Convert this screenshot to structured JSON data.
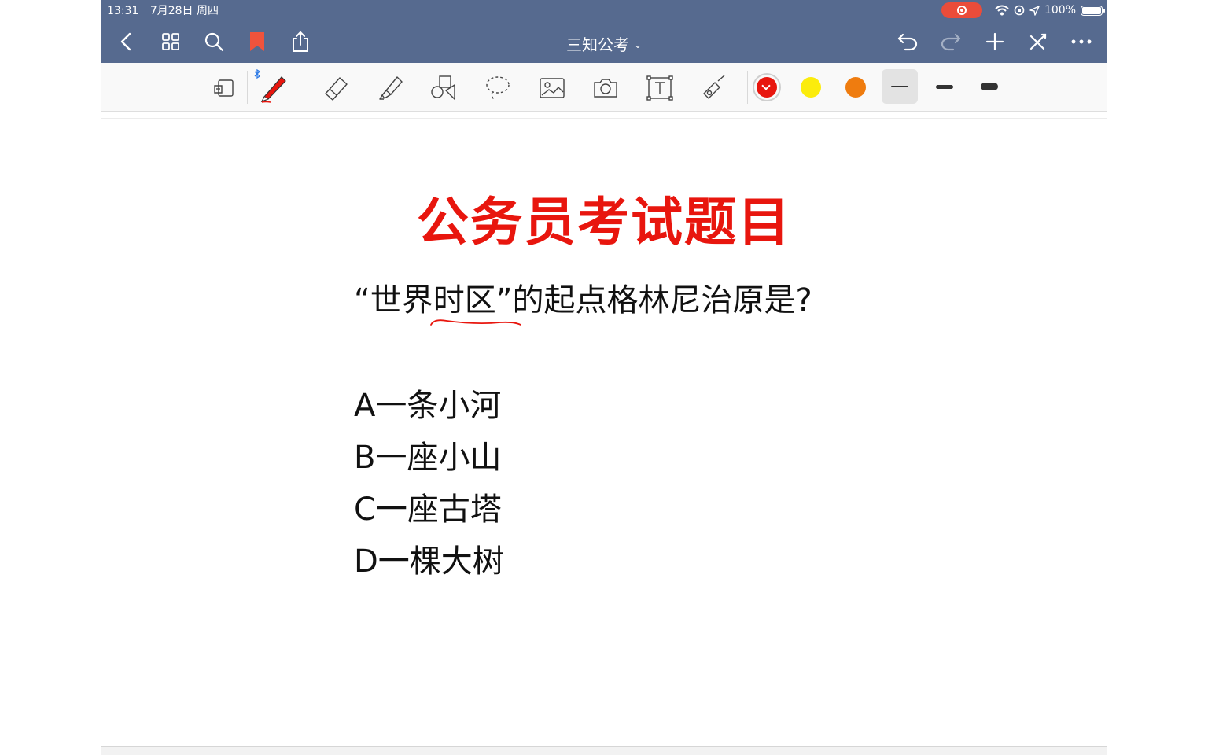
{
  "status_bar": {
    "time": "13:31",
    "date": "7月28日 周四",
    "battery": "100%"
  },
  "nav": {
    "title": "三知公考",
    "icons": [
      "back-icon",
      "grid-icon",
      "search-icon",
      "bookmark-icon",
      "share-icon",
      "undo-icon",
      "redo-icon",
      "add-icon",
      "close-edit-icon",
      "more-icon"
    ],
    "bookmark_color": "#f0533c",
    "bar_color": "#566a8f"
  },
  "toolbar": {
    "tools": [
      "read-mode-icon",
      "pen-icon",
      "eraser-icon",
      "highlighter-icon",
      "shapes-icon",
      "lasso-icon",
      "image-icon",
      "camera-icon",
      "text-icon",
      "laser-pointer-icon"
    ],
    "selected_tool": "pen-icon",
    "colors": [
      "#e8160e",
      "#fbec0c",
      "#ef7c0f"
    ],
    "selected_color": "#e8160e",
    "stroke_widths": [
      "thin",
      "medium",
      "thick"
    ],
    "selected_width": "thin"
  },
  "content": {
    "heading": "公务员考试题目",
    "question": "“世界时区”的起点格林尼治原是?",
    "options": [
      "A一条小河",
      "B一座小山",
      "C一座古塔",
      "D一棵大树"
    ],
    "heading_color": "#e8160e",
    "annotation_color": "#e8160e"
  }
}
